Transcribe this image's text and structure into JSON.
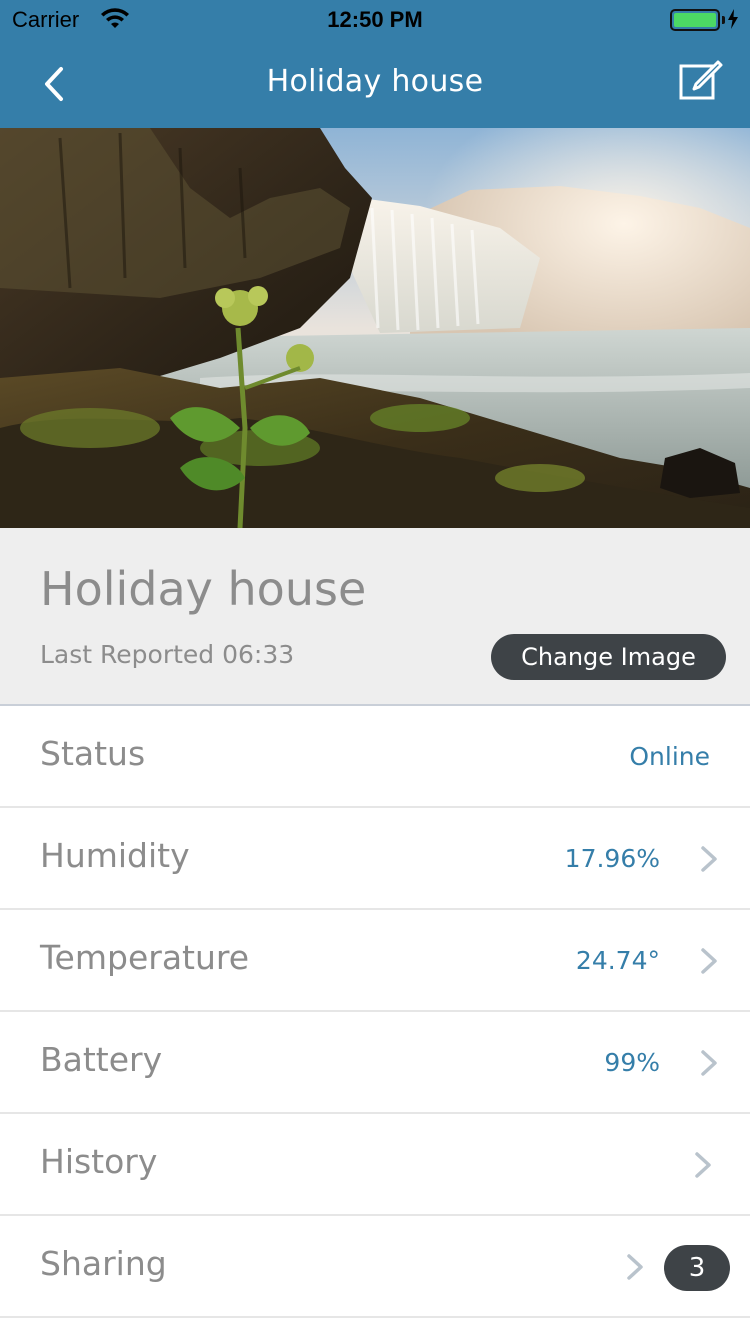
{
  "status_bar": {
    "carrier": "Carrier",
    "time": "12:50 PM",
    "battery_level": 1.0,
    "icons": [
      "wifi-icon",
      "battery-icon",
      "charging-bolt-icon"
    ]
  },
  "nav": {
    "title": "Holiday house",
    "back_icon": "chevron-left-icon",
    "edit_icon": "edit-compose-icon"
  },
  "device": {
    "name": "Holiday house",
    "last_reported": "Last Reported 06:33",
    "change_image_label": "Change Image"
  },
  "rows": [
    {
      "label": "Status",
      "value": "Online",
      "chevron": false
    },
    {
      "label": "Humidity",
      "value": "17.96%",
      "chevron": true
    },
    {
      "label": "Temperature",
      "value": "24.74°",
      "chevron": true
    },
    {
      "label": "Battery",
      "value": "99%",
      "chevron": true
    },
    {
      "label": "History",
      "value": "",
      "chevron": true
    },
    {
      "label": "Sharing",
      "badge": "3",
      "chevron": true
    }
  ],
  "colors": {
    "accent": "#357ea9",
    "dark_pill": "#3e4347",
    "label_gray": "#8c8c8c",
    "header_bg": "#eeeeee"
  }
}
